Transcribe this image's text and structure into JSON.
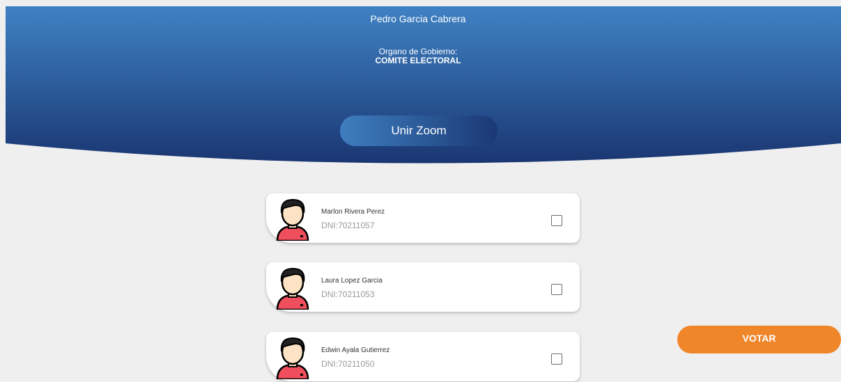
{
  "header": {
    "user_name": "Pedro Garcia Cabrera",
    "organ_label": "Organo de Gobierno:",
    "organ_value": "COMITE ELECTORAL",
    "zoom_button_label": "Unir Zoom"
  },
  "candidates": [
    {
      "name": "Marlon Rivera Perez",
      "dni": "DNI:70211057"
    },
    {
      "name": "Laura Lopez Garcia",
      "dni": "DNI:70211053"
    },
    {
      "name": "Edwin Ayala Gutierrez",
      "dni": "DNI:70211050"
    }
  ],
  "vote_button_label": "VOTAR",
  "colors": {
    "header_top": "#3f82c4",
    "header_bottom": "#1a3672",
    "vote_button": "#f0862a",
    "background": "#efefef"
  },
  "icons": {
    "avatar": "person-avatar-icon",
    "checkbox": "checkbox-unchecked-icon"
  }
}
